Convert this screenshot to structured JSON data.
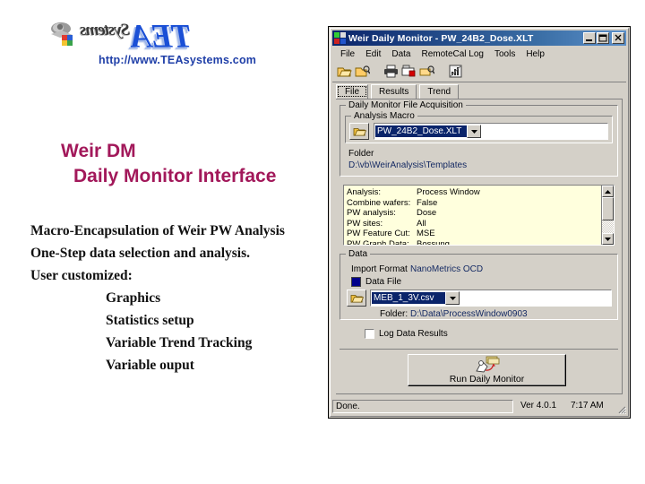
{
  "slide": {
    "logo_text": "TEA",
    "logo_suffix": "Systems",
    "url": "http://www.TEAsystems.com",
    "title_line1": "Weir DM",
    "title_line2": "Daily Monitor Interface",
    "title_color": "#a2185a",
    "body_lines": [
      "Macro-Encapsulation of Weir PW Analysis",
      "One-Step data selection and analysis.",
      "User customized:"
    ],
    "body_indented": [
      "Graphics",
      "Statistics setup",
      "Variable Trend Tracking",
      "Variable ouput"
    ]
  },
  "window": {
    "title": "Weir Daily Monitor - PW_24B2_Dose.XLT",
    "titlebar_color": "#0a246a",
    "buttons": {
      "minimize": "_",
      "maximize": "□",
      "close": "×"
    },
    "menu": [
      "File",
      "Edit",
      "Data",
      "RemoteCal Log",
      "Tools",
      "Help"
    ],
    "toolbar_icons": [
      "open-folder-icon",
      "open-with-icon",
      "print-icon",
      "print-preview-icon",
      "print-setup-icon",
      "chart-icon"
    ],
    "tabs": [
      {
        "label": "File",
        "active": true
      },
      {
        "label": "Results",
        "active": false
      },
      {
        "label": "Trend",
        "active": false
      }
    ],
    "acquisition": {
      "group_label": "Daily Monitor File Acquisition",
      "macro_label": "Analysis Macro",
      "macro_value": "PW_24B2_Dose.XLT",
      "folder_label": "Folder",
      "folder_value": "D:\\vb\\WeirAnalysis\\Templates"
    },
    "info_panel": {
      "rows": [
        {
          "key": "Analysis:",
          "value": "Process Window"
        },
        {
          "key": "Combine wafers:",
          "value": "False"
        },
        {
          "key": "PW analysis:",
          "value": "Dose"
        },
        {
          "key": "PW sites:",
          "value": "All"
        },
        {
          "key": "PW Feature Cut:",
          "value": "MSE"
        },
        {
          "key": "PW Graph Data:",
          "value": "Bossung"
        }
      ]
    },
    "data_group": {
      "group_label": "Data",
      "import_format_label": "Import Format",
      "import_format_value": "NanoMetrics OCD",
      "data_file_label": "Data File",
      "data_file_value": "MEB_1_3V.csv",
      "folder_label": "Folder:",
      "folder_value": "D:\\Data\\ProcessWindow0903"
    },
    "log_checkbox_label": "Log Data Results",
    "run_button_label": "Run Daily Monitor",
    "statusbar": {
      "message": "Done.",
      "version": "Ver 4.0.1",
      "time": "7:17 AM"
    }
  }
}
